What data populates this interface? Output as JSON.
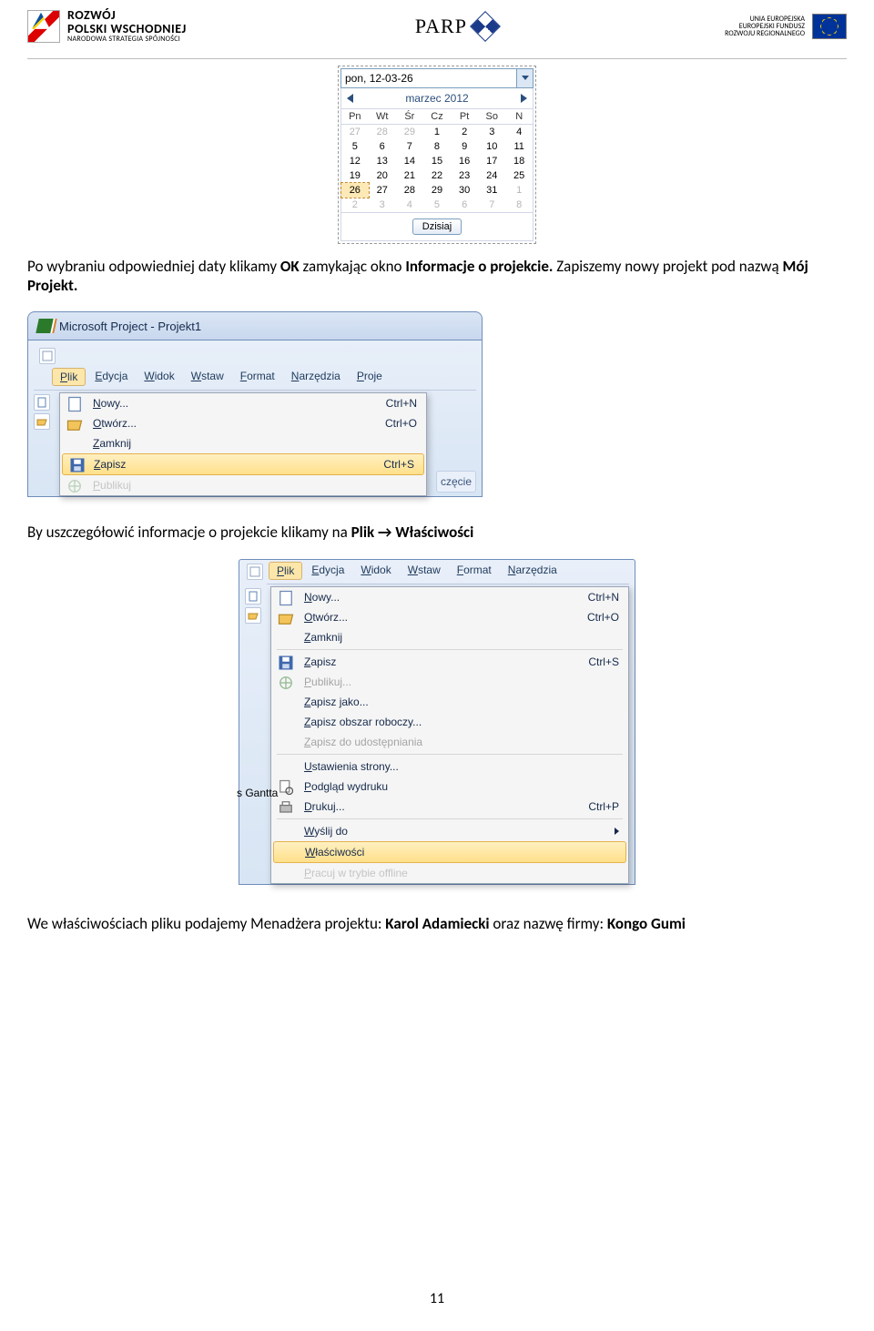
{
  "header": {
    "left": {
      "line1": "ROZWÓJ",
      "line2": "POLSKI WSCHODNIEJ",
      "line3": "NARODOWA STRATEGIA SPÓJNOŚCI"
    },
    "center": {
      "text": "PARP"
    },
    "right": {
      "line1": "UNIA EUROPEJSKA",
      "line2": "EUROPEJSKI FUNDUSZ",
      "line3": "ROZWOJU REGIONALNEGO"
    }
  },
  "calendar": {
    "input_value": "pon, 12-03-26",
    "month_label": "marzec 2012",
    "days_header": [
      "Pn",
      "Wt",
      "Śr",
      "Cz",
      "Pt",
      "So",
      "N"
    ],
    "weeks": [
      [
        {
          "d": "27",
          "grey": true
        },
        {
          "d": "28",
          "grey": true
        },
        {
          "d": "29",
          "grey": true
        },
        {
          "d": "1"
        },
        {
          "d": "2"
        },
        {
          "d": "3"
        },
        {
          "d": "4"
        }
      ],
      [
        {
          "d": "5"
        },
        {
          "d": "6"
        },
        {
          "d": "7"
        },
        {
          "d": "8"
        },
        {
          "d": "9"
        },
        {
          "d": "10"
        },
        {
          "d": "11"
        }
      ],
      [
        {
          "d": "12"
        },
        {
          "d": "13"
        },
        {
          "d": "14"
        },
        {
          "d": "15"
        },
        {
          "d": "16"
        },
        {
          "d": "17"
        },
        {
          "d": "18"
        }
      ],
      [
        {
          "d": "19"
        },
        {
          "d": "20"
        },
        {
          "d": "21"
        },
        {
          "d": "22"
        },
        {
          "d": "23"
        },
        {
          "d": "24"
        },
        {
          "d": "25"
        }
      ],
      [
        {
          "d": "26",
          "sel": true
        },
        {
          "d": "27"
        },
        {
          "d": "28"
        },
        {
          "d": "29"
        },
        {
          "d": "30"
        },
        {
          "d": "31"
        },
        {
          "d": "1",
          "grey": true
        }
      ],
      [
        {
          "d": "2",
          "grey": true
        },
        {
          "d": "3",
          "grey": true
        },
        {
          "d": "4",
          "grey": true
        },
        {
          "d": "5",
          "grey": true
        },
        {
          "d": "6",
          "grey": true
        },
        {
          "d": "7",
          "grey": true
        },
        {
          "d": "8",
          "grey": true
        }
      ]
    ],
    "today_btn": "Dzisiaj"
  },
  "para1": {
    "pre": "Po wybraniu odpowiedniej daty klikamy ",
    "b1": "OK",
    "mid1": " zamykając okno ",
    "b2": "Informacje o projekcie.",
    "mid2": " Zapiszemy nowy projekt pod nazwą ",
    "b3": "Mój Projekt."
  },
  "shot1": {
    "title": "Microsoft Project - Projekt1",
    "menus": [
      "Plik",
      "Edycja",
      "Widok",
      "Wstaw",
      "Format",
      "Narzędzia",
      "Proje"
    ],
    "items": [
      {
        "label": "Nowy...",
        "icon": "new",
        "shortcut": "Ctrl+N"
      },
      {
        "label": "Otwórz...",
        "icon": "open",
        "shortcut": "Ctrl+O"
      },
      {
        "label": "Zamknij"
      },
      {
        "label": "Zapisz",
        "icon": "save",
        "shortcut": "Ctrl+S",
        "hl": true
      },
      {
        "label": "Publikuj",
        "icon": "pub",
        "disabled": true,
        "cut": true
      }
    ],
    "side_word": "częcie"
  },
  "para2": {
    "pre": "By uszczegółowić informacje o projekcie klikamy na ",
    "b1": "Plik",
    "arrow": " → ",
    "b2": "Właściwości"
  },
  "shot2": {
    "menus": [
      "Plik",
      "Edycja",
      "Widok",
      "Wstaw",
      "Format",
      "Narzędzia"
    ],
    "items": [
      {
        "label": "Nowy...",
        "icon": "new",
        "shortcut": "Ctrl+N"
      },
      {
        "label": "Otwórz...",
        "icon": "open",
        "shortcut": "Ctrl+O"
      },
      {
        "label": "Zamknij"
      },
      {
        "sep": true
      },
      {
        "label": "Zapisz",
        "icon": "save",
        "shortcut": "Ctrl+S"
      },
      {
        "label": "Publikuj...",
        "icon": "pub",
        "disabled": true
      },
      {
        "label": "Zapisz jako..."
      },
      {
        "label": "Zapisz obszar roboczy..."
      },
      {
        "label": "Zapisz do udostępniania",
        "disabled": true
      },
      {
        "sep": true
      },
      {
        "label": "Ustawienia strony..."
      },
      {
        "label": "Podgląd wydruku",
        "icon": "prev"
      },
      {
        "label": "Drukuj...",
        "icon": "print",
        "shortcut": "Ctrl+P"
      },
      {
        "sep": true
      },
      {
        "label": "Wyślij do",
        "sub": true
      },
      {
        "label": "Właściwości",
        "hl": true
      },
      {
        "label": "Pracuj w trybie offline",
        "disabled": true,
        "cut": true
      }
    ],
    "gantt_label": "s Gantta"
  },
  "para3": {
    "pre": "We właściwościach pliku podajemy Menadżera projektu: ",
    "b1": "Karol Adamiecki",
    "mid": " oraz nazwę firmy: ",
    "b2": "Kongo Gumi"
  },
  "page_number": "11"
}
